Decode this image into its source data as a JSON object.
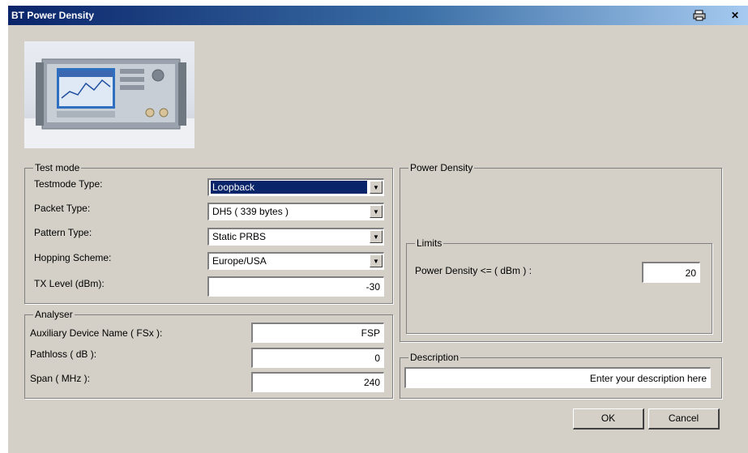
{
  "window": {
    "title": "BT Power Density"
  },
  "icons": {
    "print": "printer-icon",
    "close": "close-icon"
  },
  "test_mode": {
    "legend": "Test mode",
    "testmode_type": {
      "label": "Testmode Type:",
      "value": "Loopback"
    },
    "packet_type": {
      "label": "Packet Type:",
      "value": "DH5  ( 339 bytes )"
    },
    "pattern_type": {
      "label": "Pattern Type:",
      "value": "Static PRBS"
    },
    "hopping_scheme": {
      "label": "Hopping Scheme:",
      "value": "Europe/USA"
    },
    "tx_level": {
      "label": "TX Level (dBm):",
      "value": "-30"
    }
  },
  "analyser": {
    "legend": "Analyser",
    "aux_device": {
      "label": "Auxiliary Device Name ( FSx ):",
      "value": "FSP"
    },
    "pathloss": {
      "label": "Pathloss ( dB ):",
      "value": "0"
    },
    "span": {
      "label": "Span ( MHz ):",
      "value": "240"
    }
  },
  "power_density": {
    "legend": "Power Density",
    "limits": {
      "legend": "Limits",
      "power_density_max": {
        "label": "Power Density <= ( dBm ) :",
        "value": "20"
      }
    }
  },
  "description": {
    "legend": "Description",
    "value": "Enter your description here"
  },
  "buttons": {
    "ok": "OK",
    "cancel": "Cancel"
  },
  "colors": {
    "dialog_bg": "#d4d0c8",
    "title_start": "#0a246a",
    "title_end": "#a6caf0",
    "selection": "#0a246a"
  }
}
